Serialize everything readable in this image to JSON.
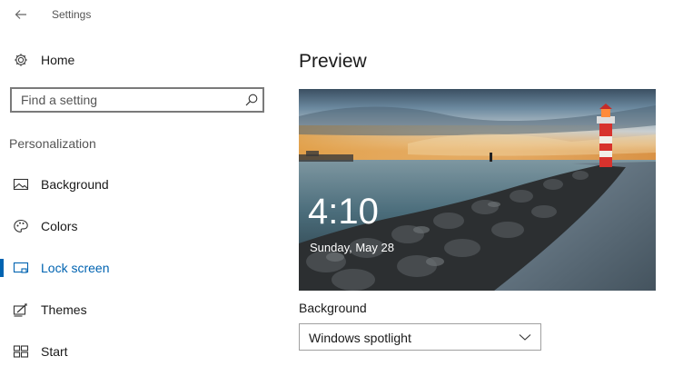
{
  "window": {
    "title": "Settings"
  },
  "sidebar": {
    "home_label": "Home",
    "search": {
      "placeholder": "Find a setting",
      "value": ""
    },
    "section_label": "Personalization",
    "items": [
      {
        "label": "Background",
        "icon": "picture-icon",
        "active": false
      },
      {
        "label": "Colors",
        "icon": "palette-icon",
        "active": false
      },
      {
        "label": "Lock screen",
        "icon": "lock-screen-icon",
        "active": true
      },
      {
        "label": "Themes",
        "icon": "themes-icon",
        "active": false
      },
      {
        "label": "Start",
        "icon": "start-icon",
        "active": false
      }
    ]
  },
  "main": {
    "title": "Preview",
    "preview": {
      "time": "4:10",
      "date": "Sunday, May 28"
    },
    "background_label": "Background",
    "background_select": {
      "value": "Windows spotlight"
    }
  },
  "colors": {
    "accent": "#0063b1",
    "text": "#1a1a1a",
    "muted": "#555555"
  }
}
